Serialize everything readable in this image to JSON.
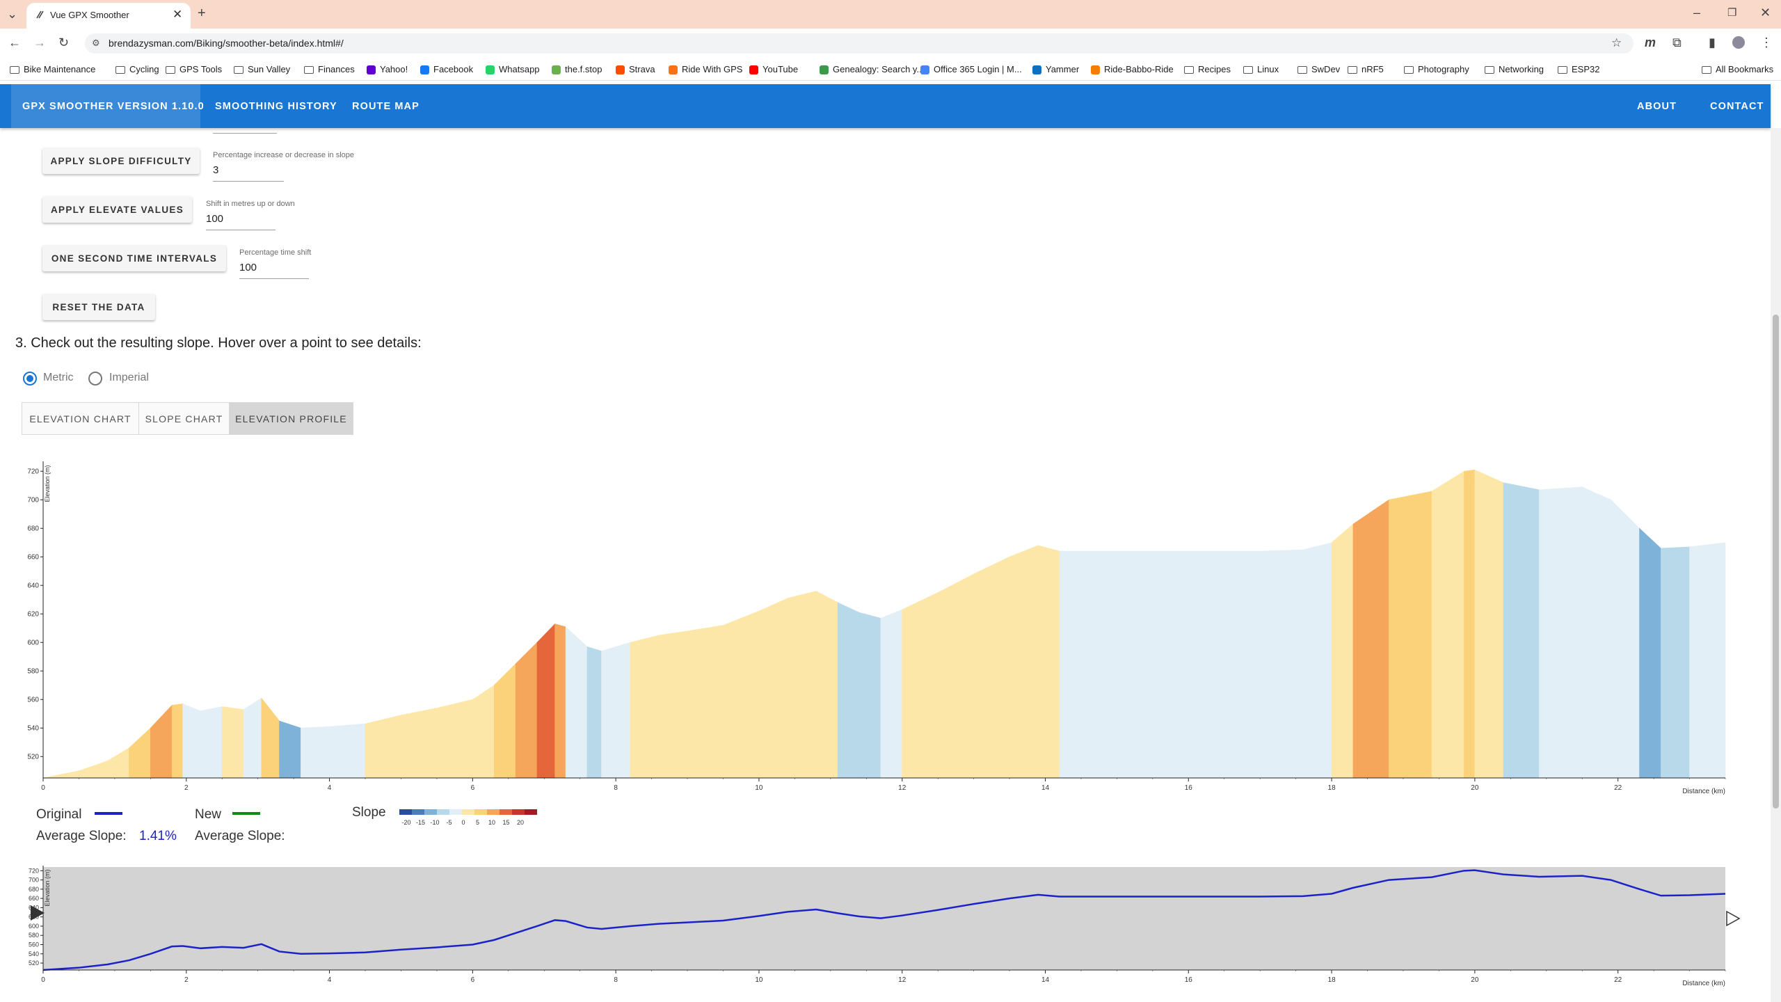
{
  "browser": {
    "tab_title": "Vue GPX Smoother",
    "url": "brendazysman.com/Biking/smoother-beta/index.html#/",
    "bookmarks": [
      {
        "label": "Bike Maintenance",
        "icon": "folder-icon"
      },
      {
        "label": "Cycling",
        "icon": "folder-icon"
      },
      {
        "label": "GPS Tools",
        "icon": "folder-icon"
      },
      {
        "label": "Sun Valley",
        "icon": "folder-icon"
      },
      {
        "label": "Finances",
        "icon": "folder-icon"
      },
      {
        "label": "Yahoo!",
        "icon": "yahoo-icon"
      },
      {
        "label": "Facebook",
        "icon": "facebook-icon"
      },
      {
        "label": "Whatsapp",
        "icon": "whatsapp-icon"
      },
      {
        "label": "the.f.stop",
        "icon": "fstop-icon"
      },
      {
        "label": "Strava",
        "icon": "strava-icon"
      },
      {
        "label": "Ride With GPS",
        "icon": "ridewithgps-icon"
      },
      {
        "label": "YouTube",
        "icon": "youtube-icon"
      },
      {
        "label": "Genealogy: Search y...",
        "icon": "genealogy-icon"
      },
      {
        "label": "Office 365 Login | M...",
        "icon": "office-icon"
      },
      {
        "label": "Yammer",
        "icon": "yammer-icon"
      },
      {
        "label": "Ride-Babbo-Ride",
        "icon": "blogger-icon"
      },
      {
        "label": "Recipes",
        "icon": "folder-icon"
      },
      {
        "label": "Linux",
        "icon": "folder-icon"
      },
      {
        "label": "SwDev",
        "icon": "folder-icon"
      },
      {
        "label": "nRF5",
        "icon": "folder-icon"
      },
      {
        "label": "Photography",
        "icon": "folder-icon"
      },
      {
        "label": "Networking",
        "icon": "folder-icon"
      },
      {
        "label": "ESP32",
        "icon": "folder-icon"
      }
    ],
    "all_bookmarks": "All Bookmarks"
  },
  "appbar": {
    "brand": "GPX SMOOTHER VERSION 1.10.0",
    "links": [
      "SMOOTHING HISTORY",
      "ROUTE MAP"
    ],
    "right_links": [
      "ABOUT",
      "CONTACT"
    ]
  },
  "controls": {
    "slope": {
      "button": "APPLY SLOPE DIFFICULTY",
      "label": "Percentage increase or decrease in slope",
      "value": "3"
    },
    "elevate": {
      "button": "APPLY ELEVATE VALUES",
      "label": "Shift in metres up or down",
      "value": "100"
    },
    "time": {
      "button": "ONE SECOND TIME INTERVALS",
      "label": "Percentage time shift",
      "value": "100"
    },
    "reset": "RESET THE DATA"
  },
  "step3": {
    "heading": "3. Check out the resulting slope. Hover over a point to see details:",
    "units": [
      {
        "label": "Metric",
        "selected": true
      },
      {
        "label": "Imperial",
        "selected": false
      }
    ],
    "tabs": [
      "ELEVATION CHART",
      "SLOPE CHART",
      "ELEVATION PROFILE"
    ],
    "active_tab": 2
  },
  "legend": {
    "original": "Original",
    "new": "New",
    "avg_label": "Average Slope:",
    "original_avg": "1.41%",
    "new_avg": "",
    "slope_title": "Slope",
    "slope_ticks": [
      "-20",
      "-15",
      "-10",
      "-5",
      "0",
      "5",
      "10",
      "15",
      "20"
    ],
    "slope_colors": [
      "#2b4c9c",
      "#4a7cc0",
      "#7fb2d8",
      "#b7d9ea",
      "#e2eff6",
      "#fde7a8",
      "#fbd27a",
      "#f5a65b",
      "#e5663a",
      "#c8352b",
      "#a11a24"
    ],
    "original_color": "#1a22c8",
    "new_color": "#148a14"
  },
  "chart_data": {
    "type": "area",
    "title": "",
    "xlabel": "Distance (km)",
    "ylabel": "Elevation (m)",
    "xlim": [
      0,
      23.5
    ],
    "ylim": [
      505,
      725
    ],
    "xticks": [
      "0",
      "2",
      "4",
      "6",
      "8",
      "10",
      "12",
      "14",
      "16",
      "18",
      "20",
      "22"
    ],
    "yticks": [
      "520",
      "540",
      "560",
      "580",
      "600",
      "620",
      "640",
      "660",
      "680",
      "700",
      "720"
    ],
    "x": [
      0,
      0.5,
      0.9,
      1.2,
      1.5,
      1.8,
      1.95,
      2.2,
      2.5,
      2.8,
      3.05,
      3.3,
      3.6,
      4.0,
      4.5,
      5.0,
      5.5,
      6.0,
      6.3,
      6.6,
      6.9,
      7.15,
      7.3,
      7.6,
      7.8,
      8.2,
      8.6,
      9.0,
      9.5,
      10.0,
      10.4,
      10.8,
      11.1,
      11.4,
      11.7,
      12.0,
      12.5,
      13.0,
      13.5,
      13.9,
      14.2,
      15.0,
      16.0,
      17.0,
      17.6,
      18.0,
      18.3,
      18.8,
      19.4,
      19.85,
      20.0,
      20.4,
      20.9,
      21.5,
      21.9,
      22.3,
      22.6,
      23.0,
      23.5
    ],
    "elevation": [
      505,
      510,
      517,
      526,
      540,
      556,
      557,
      552,
      555,
      553,
      561,
      545,
      540,
      541,
      543,
      549,
      554,
      560,
      570,
      585,
      600,
      613,
      611,
      597,
      594,
      600,
      605,
      608,
      612,
      622,
      631,
      636,
      628,
      621,
      617,
      623,
      635,
      648,
      660,
      668,
      664,
      664,
      664,
      664,
      665,
      670,
      683,
      700,
      706,
      720,
      721,
      712,
      707,
      709,
      700,
      680,
      666,
      667,
      670
    ],
    "slope_by_segment": [
      2,
      2,
      3,
      4,
      6,
      5,
      0,
      -2,
      1,
      -1,
      5,
      -7,
      -2,
      0,
      1,
      2,
      2,
      2,
      5,
      7,
      9,
      8,
      -2,
      -5,
      -2,
      3,
      2,
      1,
      1,
      3,
      3,
      2,
      -3,
      -3,
      -2,
      2,
      3,
      3,
      3,
      2,
      -1,
      0,
      0,
      0,
      0,
      2,
      6,
      5,
      2,
      4,
      1,
      -3,
      -1,
      0,
      -2,
      -7,
      -5,
      0,
      1
    ]
  }
}
